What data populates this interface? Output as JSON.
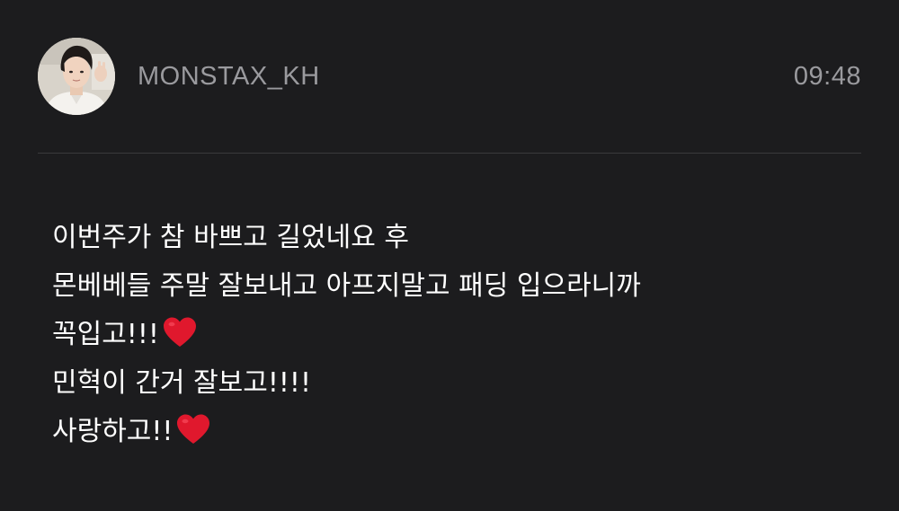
{
  "post": {
    "username": "MONSTAX_KH",
    "time": "09:48",
    "lines": [
      "이번주가 참 바쁘고 길었네요 후",
      "몬베베들 주말 잘보내고 아프지말고 패딩 입으라니까",
      "꼭입고!!!",
      "민혁이 간거 잘보고!!!!",
      "사랑하고!!"
    ],
    "avatar_icon": "profile-photo",
    "heart_icon": "red-heart-emoji"
  },
  "colors": {
    "background": "#1c1c1e",
    "muted_text": "#9a9a9e",
    "divider": "#3a3a3c",
    "heart": "#e0182d"
  }
}
